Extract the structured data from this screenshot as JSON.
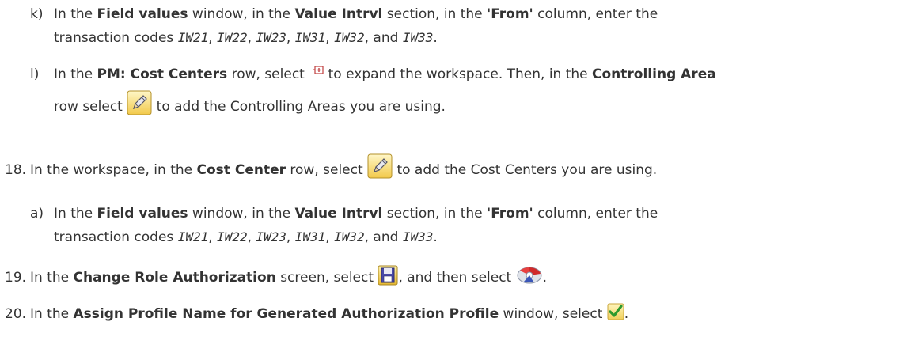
{
  "step_k": {
    "marker": "k)",
    "t1": "In the ",
    "b1": "Field values",
    "t2": " window, in the ",
    "b2": "Value Intrvl",
    "t3": " section, in the ",
    "b3": "'From'",
    "t4": " column, enter the",
    "t5": "transaction codes ",
    "codes": [
      "IW21",
      "IW22",
      "IW23",
      "IW31",
      "IW32",
      "IW33"
    ],
    "sep": ", ",
    "and": ", and ",
    "end": "."
  },
  "step_l": {
    "marker": "l)",
    "t1": "In the ",
    "b1": "PM: Cost Centers",
    "t2": " row, select ",
    "t3": " to expand the workspace. Then, in the ",
    "b2": "Controlling Area",
    "t4": "row select ",
    "t5": " to add the Controlling Areas you are using."
  },
  "step_18": {
    "marker": "18.",
    "t1": "In the workspace, in the ",
    "b1": "Cost Center",
    "t2": " row, select ",
    "t3": " to add the Cost Centers you are using."
  },
  "step_18a": {
    "marker": "a)",
    "t1": "In the ",
    "b1": "Field values",
    "t2": " window, in the ",
    "b2": "Value Intrvl",
    "t3": " section, in the ",
    "b3": "'From'",
    "t4": " column, enter the",
    "t5": "transaction codes ",
    "codes": [
      "IW21",
      "IW22",
      "IW23",
      "IW31",
      "IW32",
      "IW33"
    ],
    "sep": ", ",
    "and": ", and ",
    "end": "."
  },
  "step_19": {
    "marker": "19.",
    "t1": "In the ",
    "b1": "Change Role Authorization",
    "t2": " screen, select ",
    "t3": ", and then select ",
    "end": "."
  },
  "step_20": {
    "marker": "20.",
    "t1": "In the ",
    "b1": "Assign Profile Name for Generated Authorization Profile",
    "t2": " window, select ",
    "end": "."
  },
  "icons": {
    "expand": "expand-workspace-icon",
    "pencil": "pencil-edit-icon",
    "save": "save-floppy-icon",
    "generate": "generate-profile-icon",
    "check": "green-check-icon"
  }
}
